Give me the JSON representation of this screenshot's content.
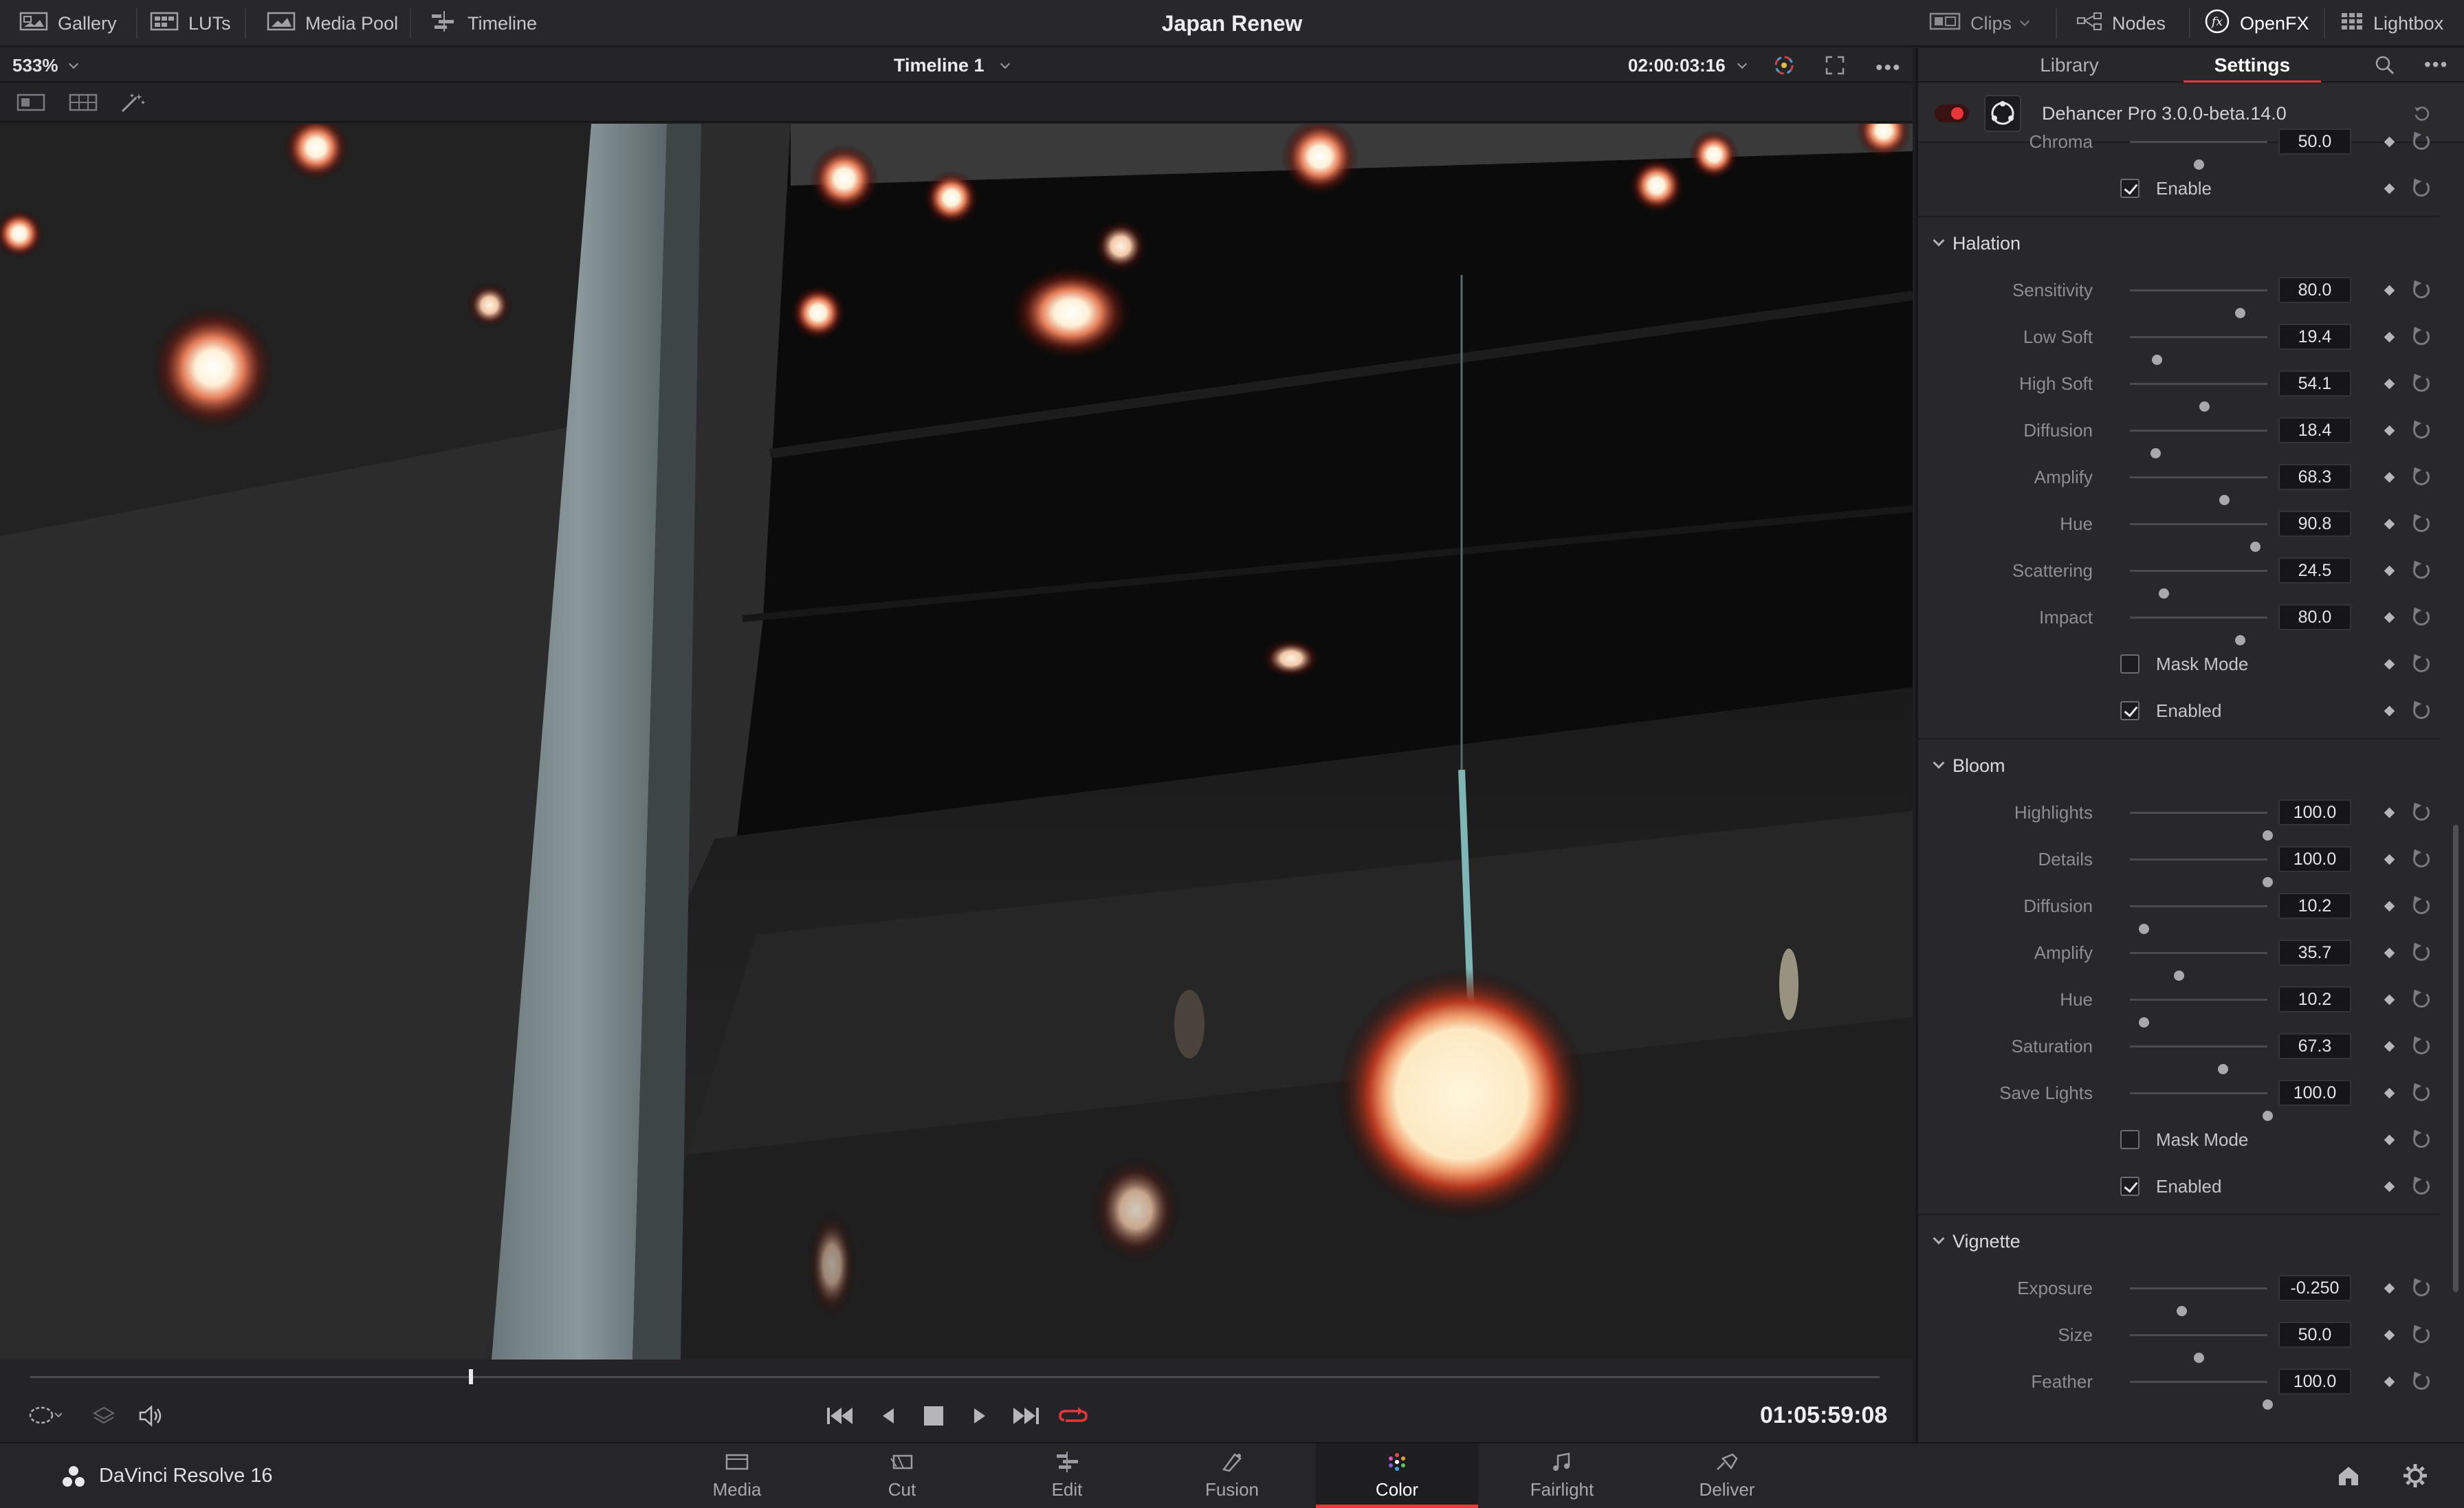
{
  "topbar": {
    "left_items": [
      {
        "label": "Gallery",
        "icon": "gallery-icon"
      },
      {
        "label": "LUTs",
        "icon": "luts-icon"
      },
      {
        "label": "Media Pool",
        "icon": "media-pool-icon"
      },
      {
        "label": "Timeline",
        "icon": "timeline-icon"
      }
    ],
    "project_title": "Japan Renew",
    "right_items": [
      {
        "label": "Clips",
        "icon": "clips-icon"
      },
      {
        "label": "Nodes",
        "icon": "nodes-icon"
      },
      {
        "label": "OpenFX",
        "icon": "openfx-icon"
      },
      {
        "label": "Lightbox",
        "icon": "lightbox-icon"
      }
    ]
  },
  "viewer": {
    "zoom": "533%",
    "timeline_name": "Timeline 1",
    "source_timecode": "02:00:03:16",
    "record_timecode": "01:05:59:08",
    "playhead_fraction": 0.237
  },
  "panel": {
    "tabs": [
      "Library",
      "Settings"
    ],
    "active_tab": "Settings",
    "plugin_name": "Dehancer Pro 3.0.0-beta.14.0",
    "rows": [
      {
        "kind": "slider",
        "label": "Chroma",
        "value": "50.0",
        "pos": 0.5
      },
      {
        "kind": "check",
        "label": "Enable",
        "checked": true
      },
      {
        "kind": "section",
        "label": "Halation"
      },
      {
        "kind": "slider",
        "label": "Sensitivity",
        "value": "80.0",
        "pos": 0.8
      },
      {
        "kind": "slider",
        "label": "Low Soft",
        "value": "19.4",
        "pos": 0.194
      },
      {
        "kind": "slider",
        "label": "High Soft",
        "value": "54.1",
        "pos": 0.541
      },
      {
        "kind": "slider",
        "label": "Diffusion",
        "value": "18.4",
        "pos": 0.184
      },
      {
        "kind": "slider",
        "label": "Amplify",
        "value": "68.3",
        "pos": 0.683
      },
      {
        "kind": "slider",
        "label": "Hue",
        "value": "90.8",
        "pos": 0.908
      },
      {
        "kind": "slider",
        "label": "Scattering",
        "value": "24.5",
        "pos": 0.245
      },
      {
        "kind": "slider",
        "label": "Impact",
        "value": "80.0",
        "pos": 0.8
      },
      {
        "kind": "check",
        "label": "Mask Mode",
        "checked": false
      },
      {
        "kind": "check",
        "label": "Enabled",
        "checked": true
      },
      {
        "kind": "section",
        "label": "Bloom"
      },
      {
        "kind": "slider",
        "label": "Highlights",
        "value": "100.0",
        "pos": 1.0
      },
      {
        "kind": "slider",
        "label": "Details",
        "value": "100.0",
        "pos": 1.0
      },
      {
        "kind": "slider",
        "label": "Diffusion",
        "value": "10.2",
        "pos": 0.102
      },
      {
        "kind": "slider",
        "label": "Amplify",
        "value": "35.7",
        "pos": 0.357
      },
      {
        "kind": "slider",
        "label": "Hue",
        "value": "10.2",
        "pos": 0.102
      },
      {
        "kind": "slider",
        "label": "Saturation",
        "value": "67.3",
        "pos": 0.673
      },
      {
        "kind": "slider",
        "label": "Save Lights",
        "value": "100.0",
        "pos": 1.0
      },
      {
        "kind": "check",
        "label": "Mask Mode",
        "checked": false
      },
      {
        "kind": "check",
        "label": "Enabled",
        "checked": true
      },
      {
        "kind": "section",
        "label": "Vignette"
      },
      {
        "kind": "slider",
        "label": "Exposure",
        "value": "-0.250",
        "pos": 0.375
      },
      {
        "kind": "slider",
        "label": "Size",
        "value": "50.0",
        "pos": 0.5
      },
      {
        "kind": "slider",
        "label": "Feather",
        "value": "100.0",
        "pos": 1.0
      }
    ]
  },
  "bottombar": {
    "app_name": "DaVinci Resolve 16",
    "pages": [
      {
        "label": "Media",
        "icon": "media-page-icon"
      },
      {
        "label": "Cut",
        "icon": "cut-page-icon"
      },
      {
        "label": "Edit",
        "icon": "edit-page-icon"
      },
      {
        "label": "Fusion",
        "icon": "fusion-page-icon"
      },
      {
        "label": "Color",
        "icon": "color-page-icon"
      },
      {
        "label": "Fairlight",
        "icon": "fairlight-page-icon"
      },
      {
        "label": "Deliver",
        "icon": "deliver-page-icon"
      }
    ],
    "active_page": "Color"
  },
  "colors": {
    "accent_red": "#e8363a",
    "panel_bg": "#28282b",
    "viewer_bg": "#060606"
  }
}
